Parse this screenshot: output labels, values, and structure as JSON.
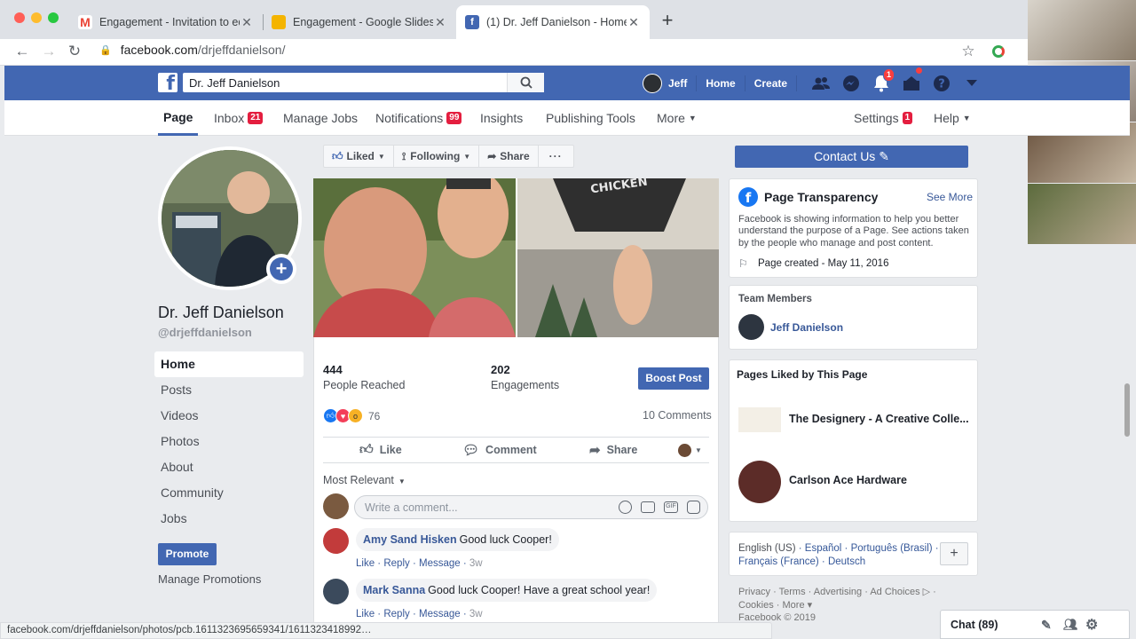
{
  "browser": {
    "tabs": [
      {
        "title": "Engagement - Invitation to edit",
        "icon": "gmail-icon"
      },
      {
        "title": "Engagement - Google Slides",
        "icon": "slides-icon"
      },
      {
        "title": "(1) Dr. Jeff Danielson - Home",
        "icon": "facebook-icon"
      }
    ],
    "url_host": "facebook.com",
    "url_path": "/drjeffdanielson/",
    "status_url": "facebook.com/drjeffdanielson/photos/pcb.1611323695659341/1611323418992…"
  },
  "fb_header": {
    "search_value": "Dr. Jeff Danielson",
    "user_name": "Jeff",
    "home_label": "Home",
    "create_label": "Create",
    "notif_count": "1",
    "friend_req_count": "1"
  },
  "page_tabs": {
    "page": "Page",
    "inbox": "Inbox",
    "inbox_count": "21",
    "manage_jobs": "Manage Jobs",
    "notifications": "Notifications",
    "notifications_count": "99",
    "insights": "Insights",
    "publishing_tools": "Publishing Tools",
    "more": "More",
    "settings": "Settings",
    "settings_count": "1",
    "help": "Help"
  },
  "profile": {
    "name": "Dr. Jeff Danielson",
    "handle": "@drjeffdanielson"
  },
  "left_nav": [
    "Home",
    "Posts",
    "Videos",
    "Photos",
    "About",
    "Community",
    "Jobs"
  ],
  "promote_label": "Promote",
  "manage_promotions_label": "Manage Promotions",
  "action_bar": {
    "liked": "Liked",
    "following": "Following",
    "share": "Share",
    "more": "···"
  },
  "post": {
    "reached_value": "444",
    "reached_label": "People Reached",
    "engagements_value": "202",
    "engagements_label": "Engagements",
    "boost_label": "Boost Post",
    "reaction_count": "76",
    "comments_count": "10 Comments",
    "like": "Like",
    "comment": "Comment",
    "share": "Share",
    "sort_label": "Most Relevant",
    "comment_placeholder": "Write a comment...",
    "comments": [
      {
        "author": "Amy Sand Hisken",
        "text": "Good luck Cooper!",
        "like": "Like",
        "reply": "Reply",
        "message": "Message",
        "time": "3w"
      },
      {
        "author": "Mark Sanna",
        "text": "Good luck Cooper! Have a great school year!",
        "like": "Like",
        "reply": "Reply",
        "message": "Message",
        "time": "3w"
      }
    ]
  },
  "right": {
    "contact_label": "Contact Us",
    "transparency_title": "Page Transparency",
    "see_more": "See More",
    "transparency_text": "Facebook is showing information to help you better understand the purpose of a Page. See actions taken by the people who manage and post content.",
    "page_created": "Page created - May 11, 2016",
    "team_title": "Team Members",
    "team_member": "Jeff Danielson",
    "liked_title": "Pages Liked by This Page",
    "liked_pages": [
      "The Designery - A Creative Colle...",
      "Carlson Ace Hardware"
    ],
    "languages_current": "English (US)",
    "languages": "Español · Português (Brasil) · Français (France) · Deutsch",
    "footer": "Privacy · Terms · Advertising · Ad Choices ▷ · Cookies · More ▾",
    "copyright": "Facebook © 2019"
  },
  "chat": {
    "label": "Chat (89)"
  },
  "colors": {
    "fb_blue": "#4267b2",
    "link": "#385898",
    "badge_red": "#fa3e3e"
  }
}
